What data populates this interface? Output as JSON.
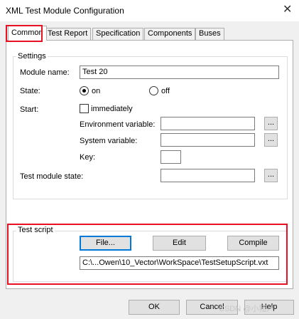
{
  "window": {
    "title": "XML Test Module Configuration",
    "close_glyph": "✕"
  },
  "tabs": [
    "Common",
    "Test Report",
    "Specification",
    "Components",
    "Buses"
  ],
  "settings": {
    "group_title": "Settings",
    "module_name_label": "Module name:",
    "module_name_value": "Test 20",
    "state_label": "State:",
    "state_on": "on",
    "state_off": "off",
    "start_label": "Start:",
    "immediately_label": "immediately",
    "env_var_label": "Environment variable:",
    "sys_var_label": "System variable:",
    "key_label": "Key:",
    "test_module_state_label": "Test module state:",
    "browse_label": "..."
  },
  "test_script": {
    "group_title": "Test script",
    "file_button": "File...",
    "edit_button": "Edit",
    "compile_button": "Compile",
    "path_value": "C:\\...Owen\\10_Vector\\WorkSpace\\TestSetupScript.vxt"
  },
  "footer": {
    "ok_button": "OK",
    "cancel_button": "Cancel",
    "help_button": "Help",
    "watermark": "CSDN @小猪八"
  },
  "colors": {
    "highlight": "#e81123",
    "focus": "#0078d7"
  }
}
